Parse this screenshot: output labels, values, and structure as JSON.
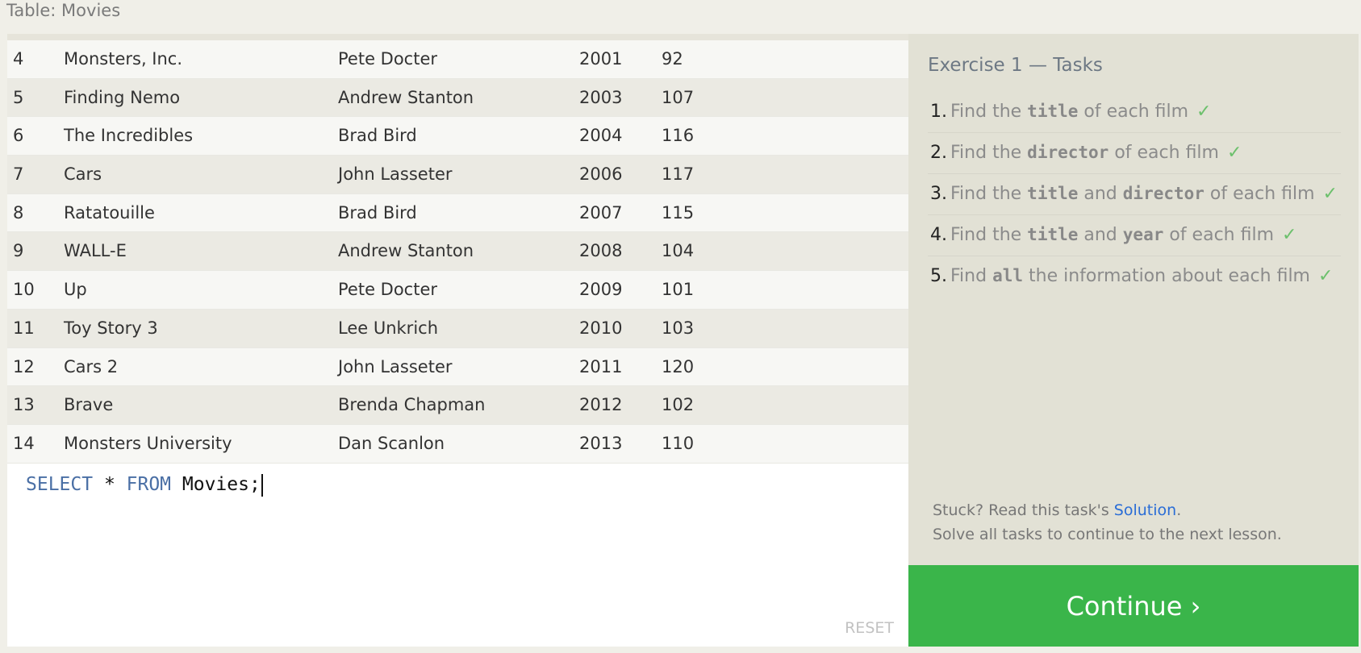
{
  "table": {
    "caption": "Table: Movies",
    "rows": [
      {
        "id": "4",
        "title": "Monsters, Inc.",
        "director": "Pete Docter",
        "year": "2001",
        "length": "92"
      },
      {
        "id": "5",
        "title": "Finding Nemo",
        "director": "Andrew Stanton",
        "year": "2003",
        "length": "107"
      },
      {
        "id": "6",
        "title": "The Incredibles",
        "director": "Brad Bird",
        "year": "2004",
        "length": "116"
      },
      {
        "id": "7",
        "title": "Cars",
        "director": "John Lasseter",
        "year": "2006",
        "length": "117"
      },
      {
        "id": "8",
        "title": "Ratatouille",
        "director": "Brad Bird",
        "year": "2007",
        "length": "115"
      },
      {
        "id": "9",
        "title": "WALL-E",
        "director": "Andrew Stanton",
        "year": "2008",
        "length": "104"
      },
      {
        "id": "10",
        "title": "Up",
        "director": "Pete Docter",
        "year": "2009",
        "length": "101"
      },
      {
        "id": "11",
        "title": "Toy Story 3",
        "director": "Lee Unkrich",
        "year": "2010",
        "length": "103"
      },
      {
        "id": "12",
        "title": "Cars 2",
        "director": "John Lasseter",
        "year": "2011",
        "length": "120"
      },
      {
        "id": "13",
        "title": "Brave",
        "director": "Brenda Chapman",
        "year": "2012",
        "length": "102"
      },
      {
        "id": "14",
        "title": "Monsters University",
        "director": "Dan Scanlon",
        "year": "2013",
        "length": "110"
      }
    ]
  },
  "editor": {
    "keyword_select": "SELECT",
    "star": " * ",
    "keyword_from": "FROM",
    "rest": " Movies;",
    "reset_label": "RESET"
  },
  "tasks": {
    "title": "Exercise 1 — Tasks",
    "items": [
      {
        "num": "1.",
        "parts": [
          {
            "t": "Find the "
          },
          {
            "t": "title",
            "code": true
          },
          {
            "t": " of each film"
          }
        ],
        "done": true
      },
      {
        "num": "2.",
        "parts": [
          {
            "t": "Find the "
          },
          {
            "t": "director",
            "code": true
          },
          {
            "t": " of each film"
          }
        ],
        "done": true
      },
      {
        "num": "3.",
        "parts": [
          {
            "t": "Find the "
          },
          {
            "t": "title",
            "code": true
          },
          {
            "t": " and "
          },
          {
            "t": "director",
            "code": true
          },
          {
            "t": " of each film"
          }
        ],
        "done": true
      },
      {
        "num": "4.",
        "parts": [
          {
            "t": "Find the "
          },
          {
            "t": "title",
            "code": true
          },
          {
            "t": " and "
          },
          {
            "t": "year",
            "code": true
          },
          {
            "t": " of each film"
          }
        ],
        "done": true
      },
      {
        "num": "5.",
        "parts": [
          {
            "t": "Find "
          },
          {
            "t": "all",
            "code": true
          },
          {
            "t": " the information about each film"
          }
        ],
        "done": true
      }
    ],
    "check_glyph": "✓"
  },
  "help": {
    "stuck_prefix": "Stuck? Read this task's ",
    "solution_link": "Solution",
    "stuck_suffix": ".",
    "note": "Solve all tasks to continue to the next lesson."
  },
  "continue_label": "Continue ›",
  "colors": {
    "continue_bg": "#3ab54a",
    "keyword": "#4a6fa5",
    "check": "#6cc06c",
    "link": "#2a6dd6"
  }
}
